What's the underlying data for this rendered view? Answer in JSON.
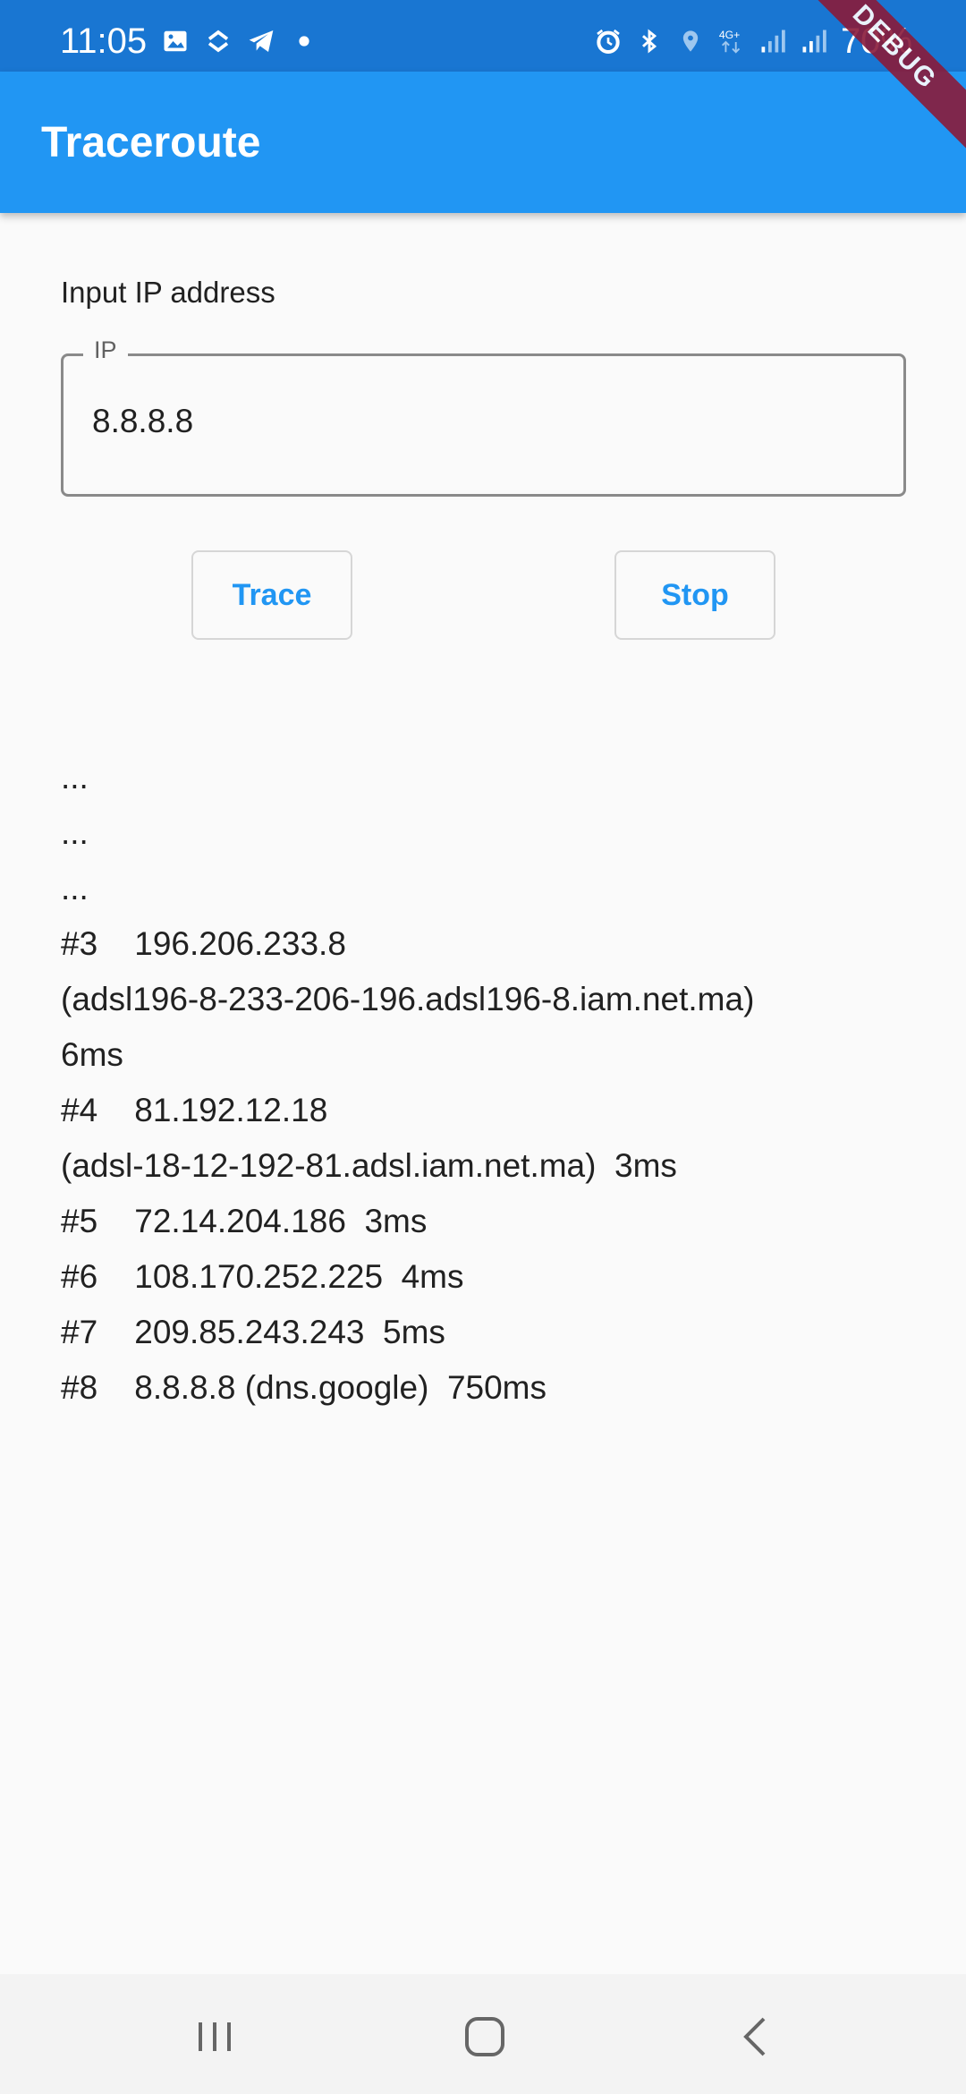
{
  "status_bar": {
    "time": "11:05",
    "battery": "70%",
    "icons_left": [
      "image-icon",
      "sync-icon",
      "telegram-icon",
      "dot-icon"
    ],
    "icons_right": [
      "alarm-icon",
      "bluetooth-icon",
      "location-icon",
      "4g-icon",
      "signal-icon",
      "signal-icon",
      "battery-icon"
    ]
  },
  "app_bar": {
    "title": "Traceroute",
    "debug_banner": "DEBUG",
    "color": "#2196f3"
  },
  "form": {
    "label": "Input IP address",
    "ip_field_label": "IP",
    "ip_value": "8.8.8.8"
  },
  "buttons": {
    "trace": "Trace",
    "stop": "Stop"
  },
  "results": [
    "...",
    "...",
    "...",
    "#3    196.206.233.8",
    "(adsl196-8-233-206-196.adsl196-8.iam.net.ma)",
    "6ms",
    "#4    81.192.12.18",
    "(adsl-18-12-192-81.adsl.iam.net.ma)  3ms",
    "#5    72.14.204.186  3ms",
    "#6    108.170.252.225  4ms",
    "#7    209.85.243.243  5ms",
    "#8    8.8.8.8 (dns.google)  750ms"
  ],
  "nav_bar": {
    "icons": [
      "recents-icon",
      "home-icon",
      "back-icon"
    ]
  }
}
